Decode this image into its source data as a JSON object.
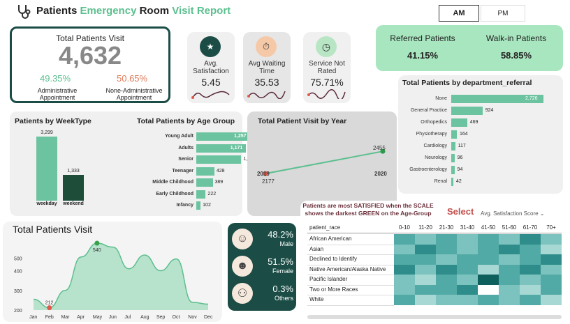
{
  "header": {
    "title_part1": "Patients ",
    "title_part2": "Emergency ",
    "title_part3": "Room ",
    "title_part4": "Visit ",
    "title_part5": "Report",
    "am_label": "AM",
    "pm_label": "PM"
  },
  "total_visits": {
    "title": "Total Patients Visit",
    "value": "4,632",
    "admin_pct": "49.35%",
    "admin_label_1": "Administrative",
    "admin_label_2": "Appointment",
    "nonadmin_pct": "50.65%",
    "nonadmin_label_1": "None-Administrative",
    "nonadmin_label_2": "Appointment"
  },
  "kpis": [
    {
      "title_1": "Avg.",
      "title_2": "Satisfaction",
      "value": "5.45",
      "icon": "stars-icon"
    },
    {
      "title_1": "Avg Waiting",
      "title_2": "Time",
      "value": "35.53",
      "icon": "clipboard-clock-icon"
    },
    {
      "title_1": "Service Not",
      "title_2": "Rated",
      "value": "75.71%",
      "icon": "stopwatch-icon"
    }
  ],
  "referral": {
    "referred_label": "Referred Patients",
    "referred_value": "41.15%",
    "walkin_label": "Walk-in Patients",
    "walkin_value": "58.85%"
  },
  "department": {
    "title": "Total Patients by department_referral",
    "rows": [
      {
        "label": "None",
        "value": 2726
      },
      {
        "label": "General Practice",
        "value": 924
      },
      {
        "label": "Orthopedics",
        "value": 469
      },
      {
        "label": "Physiotherapy",
        "value": 164
      },
      {
        "label": "Cardiology",
        "value": 117
      },
      {
        "label": "Neurology",
        "value": 96
      },
      {
        "label": "Gastroenterology",
        "value": 94
      },
      {
        "label": "Renal",
        "value": 42
      }
    ]
  },
  "weektype": {
    "title": "Patients by WeekType",
    "rows": [
      {
        "label": "weekday",
        "value": 3299,
        "display": "3,299",
        "color": "#6cc3a0"
      },
      {
        "label": "weekend",
        "value": 1333,
        "display": "1,333",
        "color": "#1e4d3a"
      }
    ]
  },
  "age_group": {
    "title": "Total Patients by Age Group",
    "rows": [
      {
        "label": "Young Adult",
        "value": 1257,
        "display": "1,257"
      },
      {
        "label": "Adults",
        "value": 1171,
        "display": "1,171"
      },
      {
        "label": "Senior",
        "value": 1063,
        "display": "1,063"
      },
      {
        "label": "Teenager",
        "value": 428,
        "display": "428"
      },
      {
        "label": "Middle Childhood",
        "value": 389,
        "display": "389"
      },
      {
        "label": "Early Childhood",
        "value": 222,
        "display": "222"
      },
      {
        "label": "Infancy",
        "value": 102,
        "display": "102"
      }
    ]
  },
  "year_visit": {
    "title": "Total Patient Visit by Year",
    "points": [
      {
        "year": "2019",
        "value": 2177
      },
      {
        "year": "2020",
        "value": 2455
      }
    ]
  },
  "monthly": {
    "title": "Total Patients Visit",
    "y_ticks": [
      "500",
      "400",
      "300",
      "200"
    ],
    "months": [
      "Jan",
      "Feb",
      "Mar",
      "Apr",
      "May",
      "Jun",
      "Jul",
      "Aug",
      "Sep",
      "Oct",
      "Nov",
      "Dec"
    ],
    "values": [
      255,
      212,
      300,
      470,
      540,
      520,
      410,
      480,
      400,
      460,
      240,
      230
    ],
    "min_label": "212",
    "max_label": "540"
  },
  "gender": {
    "rows": [
      {
        "pct": "48.2%",
        "label": "Male",
        "icon": "male-avatar-icon"
      },
      {
        "pct": "51.5%",
        "label": "Female",
        "icon": "female-avatar-icon"
      },
      {
        "pct": "0.3%",
        "label": "Others",
        "icon": "group-icon"
      }
    ]
  },
  "heatmap": {
    "note_1": "Patients are most SATISFIED when the SCALE",
    "note_2": "shows the darkest GREEN on the Age-Group",
    "select_label": "Select",
    "dropdown_value": "Avg. Satisfaction Score",
    "row_header": "patient_race",
    "columns": [
      "0-10",
      "11-20",
      "21-30",
      "31-40",
      "41-50",
      "51-60",
      "61-70",
      "70+"
    ],
    "rows": [
      {
        "label": "African American",
        "levels": [
          4,
          3,
          4,
          3,
          4,
          3,
          5,
          3
        ]
      },
      {
        "label": "Asian",
        "levels": [
          3,
          5,
          4,
          3,
          4,
          5,
          4,
          2
        ]
      },
      {
        "label": "Declined to Identify",
        "levels": [
          4,
          4,
          3,
          4,
          4,
          3,
          4,
          5
        ]
      },
      {
        "label": "Native American/Alaska Native",
        "levels": [
          5,
          3,
          5,
          4,
          2,
          4,
          5,
          3
        ]
      },
      {
        "label": "Pacific Islander",
        "levels": [
          3,
          2,
          4,
          3,
          6,
          4,
          3,
          4
        ]
      },
      {
        "label": "Two or More Races",
        "levels": [
          3,
          4,
          4,
          5,
          0,
          3,
          2,
          4
        ]
      },
      {
        "label": "White",
        "levels": [
          4,
          2,
          3,
          3,
          4,
          3,
          4,
          2
        ]
      }
    ],
    "palette": [
      "#ffffff",
      "#d2ecea",
      "#a8d8d4",
      "#7cc3bf",
      "#52aaa6",
      "#2e8d8a",
      "#0f5f5c"
    ]
  },
  "colors": {
    "accent_green": "#5cbf8f",
    "dark_teal": "#1b4d46",
    "light_green_card": "#a8e6bf",
    "bar_teal": "#6cc3a0"
  }
}
